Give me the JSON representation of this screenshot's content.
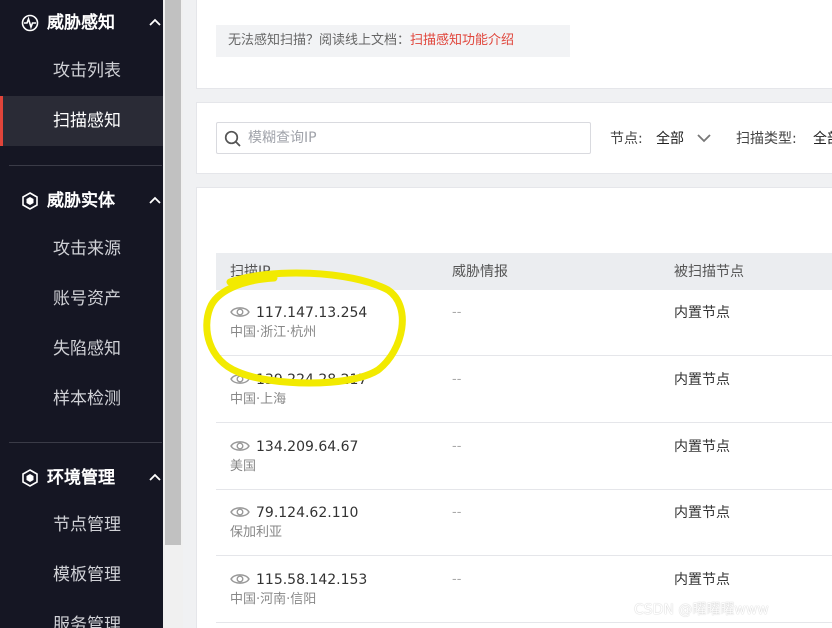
{
  "sidebar": {
    "groups": [
      {
        "title": "威胁感知",
        "icon": "radar-icon",
        "items": [
          {
            "label": "攻击列表",
            "active": false
          },
          {
            "label": "扫描感知",
            "active": true
          }
        ]
      },
      {
        "title": "威胁实体",
        "icon": "shield-hex-icon",
        "items": [
          {
            "label": "攻击来源",
            "active": false
          },
          {
            "label": "账号资产",
            "active": false
          },
          {
            "label": "失陷感知",
            "active": false
          },
          {
            "label": "样本检测",
            "active": false
          }
        ]
      },
      {
        "title": "环境管理",
        "icon": "shield-hex-icon",
        "items": [
          {
            "label": "节点管理",
            "active": false
          },
          {
            "label": "模板管理",
            "active": false
          },
          {
            "label": "服务管理",
            "active": false
          }
        ]
      }
    ]
  },
  "notice": {
    "text": "无法感知扫描？阅读线上文档：",
    "link": "扫描感知功能介绍"
  },
  "filters": {
    "search_placeholder": "模糊查询IP",
    "node_label": "节点:",
    "node_value": "全部",
    "scan_type_label": "扫描类型:",
    "scan_type_value": "全部"
  },
  "table": {
    "headers": [
      "扫描IP",
      "威胁情报",
      "被扫描节点"
    ],
    "rows": [
      {
        "ip": "117.147.13.254",
        "location": "中国·浙江·杭州",
        "intel": "--",
        "node": "内置节点"
      },
      {
        "ip": "139.224.28.217",
        "location": "中国·上海",
        "intel": "--",
        "node": "内置节点"
      },
      {
        "ip": "134.209.64.67",
        "location": "美国",
        "intel": "--",
        "node": "内置节点"
      },
      {
        "ip": "79.124.62.110",
        "location": "保加利亚",
        "intel": "--",
        "node": "内置节点"
      },
      {
        "ip": "115.58.142.153",
        "location": "中国·河南·信阳",
        "intel": "--",
        "node": "内置节点"
      }
    ]
  },
  "watermark": "CSDN @曜曜曜www",
  "colors": {
    "sidebar_bg": "#151623",
    "accent": "#e0443a",
    "highlight": "#f2ea00"
  }
}
